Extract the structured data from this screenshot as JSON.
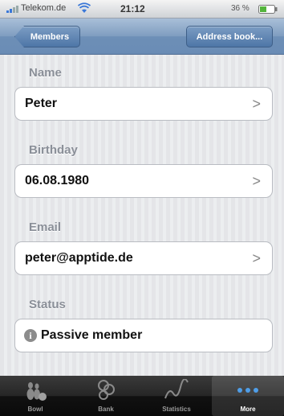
{
  "status_bar": {
    "carrier": "Telekom.de",
    "time": "21:12",
    "battery": "36 %"
  },
  "nav_bar": {
    "back_label": "Members",
    "right_label": "Address book..."
  },
  "fields": {
    "name": {
      "label": "Name",
      "value": "Peter"
    },
    "birthday": {
      "label": "Birthday",
      "value": "06.08.1980"
    },
    "email": {
      "label": "Email",
      "value": "peter@apptide.de"
    },
    "status": {
      "label": "Status",
      "value": "Passive member"
    }
  },
  "chevron": ">",
  "info_glyph": "i",
  "tab_bar": {
    "tabs": [
      {
        "label": "Bowl",
        "icon": "bowling-pins-icon"
      },
      {
        "label": "Bank",
        "icon": "coins-icon"
      },
      {
        "label": "Statistics",
        "icon": "chart-line-icon"
      },
      {
        "label": "More",
        "icon": "more-dots-icon"
      }
    ],
    "active_index": 3
  },
  "colors": {
    "nav_bar": "#7f9dc0",
    "tab_bar": "#1a1a1a",
    "section_label": "#8a8f98"
  }
}
